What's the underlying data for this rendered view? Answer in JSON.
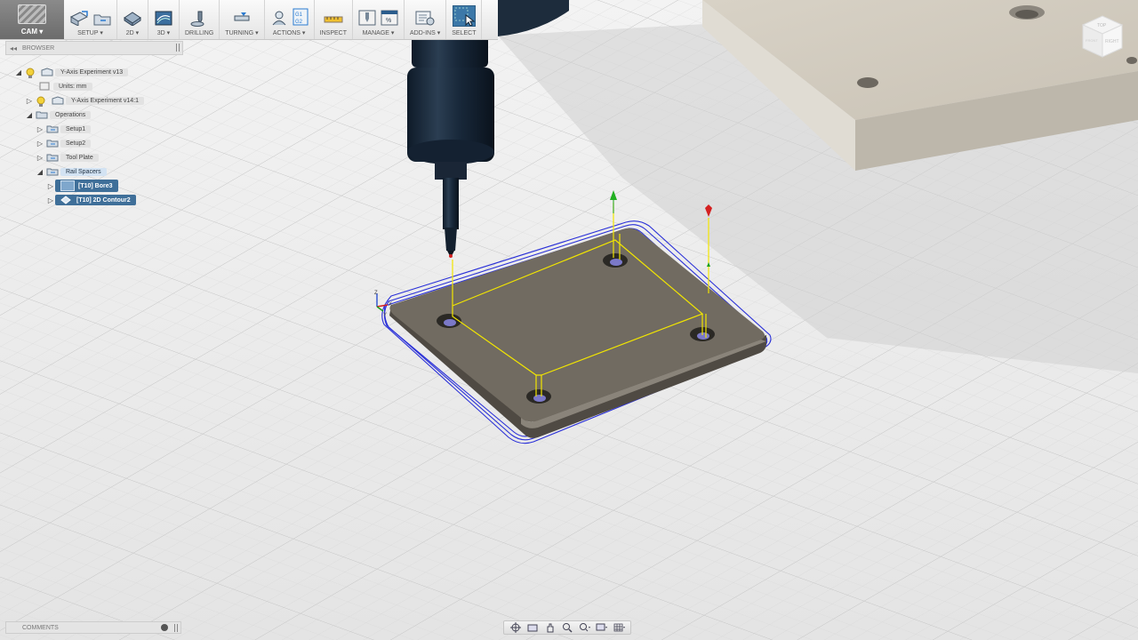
{
  "toolbar": {
    "workspace": "CAM",
    "groups": [
      {
        "label": "SETUP"
      },
      {
        "label": "2D"
      },
      {
        "label": "3D"
      },
      {
        "label": "DRILLING"
      },
      {
        "label": "TURNING"
      },
      {
        "label": "ACTIONS",
        "icon_text": "G1 G2"
      },
      {
        "label": "INSPECT"
      },
      {
        "label": "MANAGE"
      },
      {
        "label": "ADD-INS"
      },
      {
        "label": "SELECT"
      }
    ]
  },
  "browser": {
    "title": "BROWSER",
    "items": [
      {
        "label": "Y-Axis Experiment v13",
        "expanded": true,
        "icon": "component-icon"
      },
      {
        "label": "Units: mm",
        "icon": "units-icon"
      },
      {
        "label": "Y-Axis Experiment v14:1",
        "expanded": false,
        "icon": "component-icon"
      },
      {
        "label": "Operations",
        "expanded": true,
        "icon": "folder-icon"
      },
      {
        "label": "Setup1",
        "expanded": false,
        "icon": "setup-icon"
      },
      {
        "label": "Setup2",
        "expanded": false,
        "icon": "setup-icon"
      },
      {
        "label": "Tool Plate",
        "expanded": false,
        "icon": "setup-icon"
      },
      {
        "label": "Rail Spacers",
        "expanded": true,
        "icon": "setup-icon"
      },
      {
        "label": "[T10] Bore3",
        "expanded": false,
        "icon": "bore-operation-icon",
        "selected": true
      },
      {
        "label": "[T10] 2D Contour2",
        "expanded": false,
        "icon": "contour-operation-icon",
        "selected": true
      }
    ]
  },
  "comments": {
    "title": "COMMENTS"
  },
  "viewcube": {
    "face_top": "TOP",
    "face_front": "FRONT",
    "face_right": "RIGHT"
  },
  "axis_triad": {
    "x": "X",
    "y": "Y",
    "z": "Z"
  },
  "colors": {
    "toolpath": "#2a30d8",
    "lead": "#f2e600",
    "plate": "#706a5f",
    "stock": "#cfc9bd",
    "selected": "#3f6f99"
  }
}
